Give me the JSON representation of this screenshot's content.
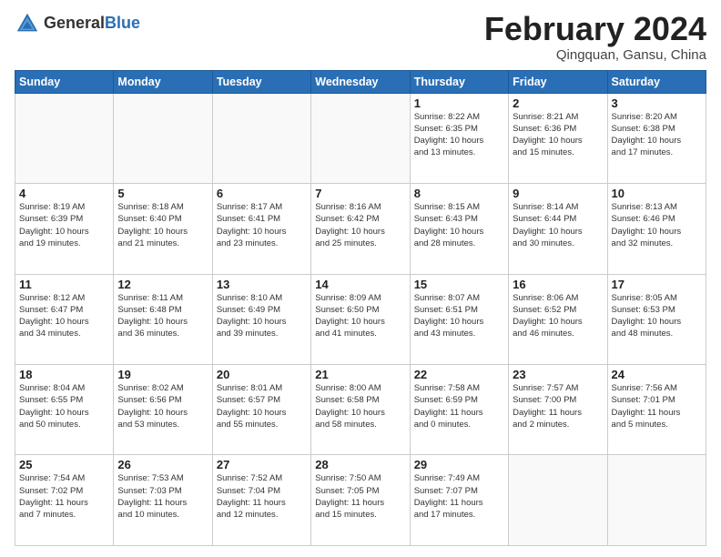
{
  "header": {
    "logo_general": "General",
    "logo_blue": "Blue",
    "month_title": "February 2024",
    "location": "Qingquan, Gansu, China"
  },
  "days_of_week": [
    "Sunday",
    "Monday",
    "Tuesday",
    "Wednesday",
    "Thursday",
    "Friday",
    "Saturday"
  ],
  "weeks": [
    [
      {
        "day": "",
        "info": ""
      },
      {
        "day": "",
        "info": ""
      },
      {
        "day": "",
        "info": ""
      },
      {
        "day": "",
        "info": ""
      },
      {
        "day": "1",
        "info": "Sunrise: 8:22 AM\nSunset: 6:35 PM\nDaylight: 10 hours\nand 13 minutes."
      },
      {
        "day": "2",
        "info": "Sunrise: 8:21 AM\nSunset: 6:36 PM\nDaylight: 10 hours\nand 15 minutes."
      },
      {
        "day": "3",
        "info": "Sunrise: 8:20 AM\nSunset: 6:38 PM\nDaylight: 10 hours\nand 17 minutes."
      }
    ],
    [
      {
        "day": "4",
        "info": "Sunrise: 8:19 AM\nSunset: 6:39 PM\nDaylight: 10 hours\nand 19 minutes."
      },
      {
        "day": "5",
        "info": "Sunrise: 8:18 AM\nSunset: 6:40 PM\nDaylight: 10 hours\nand 21 minutes."
      },
      {
        "day": "6",
        "info": "Sunrise: 8:17 AM\nSunset: 6:41 PM\nDaylight: 10 hours\nand 23 minutes."
      },
      {
        "day": "7",
        "info": "Sunrise: 8:16 AM\nSunset: 6:42 PM\nDaylight: 10 hours\nand 25 minutes."
      },
      {
        "day": "8",
        "info": "Sunrise: 8:15 AM\nSunset: 6:43 PM\nDaylight: 10 hours\nand 28 minutes."
      },
      {
        "day": "9",
        "info": "Sunrise: 8:14 AM\nSunset: 6:44 PM\nDaylight: 10 hours\nand 30 minutes."
      },
      {
        "day": "10",
        "info": "Sunrise: 8:13 AM\nSunset: 6:46 PM\nDaylight: 10 hours\nand 32 minutes."
      }
    ],
    [
      {
        "day": "11",
        "info": "Sunrise: 8:12 AM\nSunset: 6:47 PM\nDaylight: 10 hours\nand 34 minutes."
      },
      {
        "day": "12",
        "info": "Sunrise: 8:11 AM\nSunset: 6:48 PM\nDaylight: 10 hours\nand 36 minutes."
      },
      {
        "day": "13",
        "info": "Sunrise: 8:10 AM\nSunset: 6:49 PM\nDaylight: 10 hours\nand 39 minutes."
      },
      {
        "day": "14",
        "info": "Sunrise: 8:09 AM\nSunset: 6:50 PM\nDaylight: 10 hours\nand 41 minutes."
      },
      {
        "day": "15",
        "info": "Sunrise: 8:07 AM\nSunset: 6:51 PM\nDaylight: 10 hours\nand 43 minutes."
      },
      {
        "day": "16",
        "info": "Sunrise: 8:06 AM\nSunset: 6:52 PM\nDaylight: 10 hours\nand 46 minutes."
      },
      {
        "day": "17",
        "info": "Sunrise: 8:05 AM\nSunset: 6:53 PM\nDaylight: 10 hours\nand 48 minutes."
      }
    ],
    [
      {
        "day": "18",
        "info": "Sunrise: 8:04 AM\nSunset: 6:55 PM\nDaylight: 10 hours\nand 50 minutes."
      },
      {
        "day": "19",
        "info": "Sunrise: 8:02 AM\nSunset: 6:56 PM\nDaylight: 10 hours\nand 53 minutes."
      },
      {
        "day": "20",
        "info": "Sunrise: 8:01 AM\nSunset: 6:57 PM\nDaylight: 10 hours\nand 55 minutes."
      },
      {
        "day": "21",
        "info": "Sunrise: 8:00 AM\nSunset: 6:58 PM\nDaylight: 10 hours\nand 58 minutes."
      },
      {
        "day": "22",
        "info": "Sunrise: 7:58 AM\nSunset: 6:59 PM\nDaylight: 11 hours\nand 0 minutes."
      },
      {
        "day": "23",
        "info": "Sunrise: 7:57 AM\nSunset: 7:00 PM\nDaylight: 11 hours\nand 2 minutes."
      },
      {
        "day": "24",
        "info": "Sunrise: 7:56 AM\nSunset: 7:01 PM\nDaylight: 11 hours\nand 5 minutes."
      }
    ],
    [
      {
        "day": "25",
        "info": "Sunrise: 7:54 AM\nSunset: 7:02 PM\nDaylight: 11 hours\nand 7 minutes."
      },
      {
        "day": "26",
        "info": "Sunrise: 7:53 AM\nSunset: 7:03 PM\nDaylight: 11 hours\nand 10 minutes."
      },
      {
        "day": "27",
        "info": "Sunrise: 7:52 AM\nSunset: 7:04 PM\nDaylight: 11 hours\nand 12 minutes."
      },
      {
        "day": "28",
        "info": "Sunrise: 7:50 AM\nSunset: 7:05 PM\nDaylight: 11 hours\nand 15 minutes."
      },
      {
        "day": "29",
        "info": "Sunrise: 7:49 AM\nSunset: 7:07 PM\nDaylight: 11 hours\nand 17 minutes."
      },
      {
        "day": "",
        "info": ""
      },
      {
        "day": "",
        "info": ""
      }
    ]
  ]
}
